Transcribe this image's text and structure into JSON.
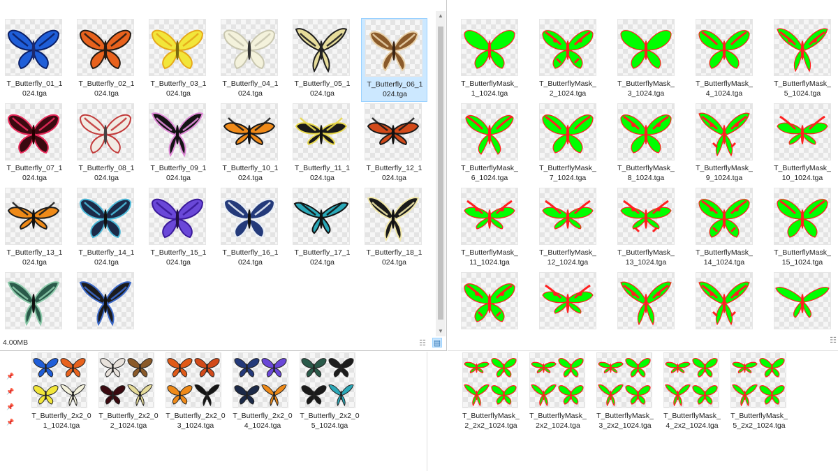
{
  "colors": {
    "mask_green": "#00ff00",
    "mask_red": "#ff2020",
    "selection": "#cce8ff"
  },
  "top_left": {
    "status": "4.00MB",
    "selected_index": 5,
    "scroll_up": "▲",
    "scroll_down": "▼",
    "view_details_icon": "☷",
    "view_tiles_icon": "▤",
    "items": [
      {
        "name": "T_Butterfly_01_1\n024.tga",
        "body": "#1e2a6e",
        "wing": "#1f5ed8",
        "accent": "#0b1f66",
        "shape": "morpho"
      },
      {
        "name": "T_Butterfly_02_1\n024.tga",
        "body": "#2a1a10",
        "wing": "#e8621d",
        "accent": "#231a14",
        "shape": "monarch"
      },
      {
        "name": "T_Butterfly_03_1\n024.tga",
        "body": "#7a6a10",
        "wing": "#f2e63a",
        "accent": "#e6a81a",
        "shape": "brimstone"
      },
      {
        "name": "T_Butterfly_04_1\n024.tga",
        "body": "#333",
        "wing": "#f4f2dc",
        "accent": "#c9c7b0",
        "shape": "white"
      },
      {
        "name": "T_Butterfly_05_1\n024.tga",
        "body": "#222",
        "wing": "#e6dc9a",
        "accent": "#1e1e1e",
        "shape": "swallow"
      },
      {
        "name": "T_Butterfly_06_1\n024.tga",
        "body": "#3a2414",
        "wing": "#8a5a2a",
        "accent": "#e8d0a8",
        "shape": "leaf"
      },
      {
        "name": "T_Butterfly_07_1\n024.tga",
        "body": "#200",
        "wing": "#3a0a10",
        "accent": "#e8285a",
        "shape": "round"
      },
      {
        "name": "T_Butterfly_08_1\n024.tga",
        "body": "#444",
        "wing": "#f1ece4",
        "accent": "#c23a3a",
        "shape": "apollo"
      },
      {
        "name": "T_Butterfly_09_1\n024.tga",
        "body": "#111",
        "wing": "#141414",
        "accent": "#e08ad8",
        "shape": "swallow"
      },
      {
        "name": "T_Butterfly_10_1\n024.tga",
        "body": "#111",
        "wing": "#f08a18",
        "accent": "#181818",
        "shape": "long"
      },
      {
        "name": "T_Butterfly_11_1\n024.tga",
        "body": "#111",
        "wing": "#1a1a1a",
        "accent": "#e8d84a",
        "shape": "long"
      },
      {
        "name": "T_Butterfly_12_1\n024.tga",
        "body": "#111",
        "wing": "#d24a1a",
        "accent": "#1a1a1a",
        "shape": "long"
      },
      {
        "name": "T_Butterfly_13_1\n024.tga",
        "body": "#111",
        "wing": "#ef8a18",
        "accent": "#1c1c1c",
        "shape": "long"
      },
      {
        "name": "T_Butterfly_14_1\n024.tga",
        "body": "#111",
        "wing": "#1c2a48",
        "accent": "#4ab8d8",
        "shape": "round"
      },
      {
        "name": "T_Butterfly_15_1\n024.tga",
        "body": "#221144",
        "wing": "#6a48d8",
        "accent": "#3a1a9a",
        "shape": "morpho"
      },
      {
        "name": "T_Butterfly_16_1\n024.tga",
        "body": "#111",
        "wing": "#243a7a",
        "accent": "#e8eef6",
        "shape": "round"
      },
      {
        "name": "T_Butterfly_17_1\n024.tga",
        "body": "#111",
        "wing": "#2aa8b8",
        "accent": "#111",
        "shape": "birdwing"
      },
      {
        "name": "T_Butterfly_18_1\n024.tga",
        "body": "#111",
        "wing": "#1a1a1a",
        "accent": "#f2e8a8",
        "shape": "swallow"
      },
      {
        "name": "",
        "body": "#111",
        "wing": "#2a5a4a",
        "accent": "#8ac8a8",
        "shape": "swallow"
      },
      {
        "name": "",
        "body": "#111",
        "wing": "#1c1c1c",
        "accent": "#3a68c8",
        "shape": "swallow"
      }
    ]
  },
  "top_right": {
    "view_details_icon": "☷",
    "items": [
      {
        "name": "T_ButterflyMask_\n1_1024.tga",
        "shape": "morpho",
        "red": 0
      },
      {
        "name": "T_ButterflyMask_\n2_1024.tga",
        "shape": "monarch",
        "red": 3
      },
      {
        "name": "T_ButterflyMask_\n3_1024.tga",
        "shape": "brimstone",
        "red": 0
      },
      {
        "name": "T_ButterflyMask_\n4_1024.tga",
        "shape": "white",
        "red": 1
      },
      {
        "name": "T_ButterflyMask_\n5_1024.tga",
        "shape": "swallow",
        "red": 2
      },
      {
        "name": "T_ButterflyMask_\n6_1024.tga",
        "shape": "leaf",
        "red": 1
      },
      {
        "name": "T_ButterflyMask_\n7_1024.tga",
        "shape": "round",
        "red": 1
      },
      {
        "name": "T_ButterflyMask_\n8_1024.tga",
        "shape": "apollo",
        "red": 2
      },
      {
        "name": "T_ButterflyMask_\n9_1024.tga",
        "shape": "swallow",
        "red": 3
      },
      {
        "name": "T_ButterflyMask_\n10_1024.tga",
        "shape": "long",
        "red": 1
      },
      {
        "name": "T_ButterflyMask_\n11_1024.tga",
        "shape": "long",
        "red": 2
      },
      {
        "name": "T_ButterflyMask_\n12_1024.tga",
        "shape": "long",
        "red": 1
      },
      {
        "name": "T_ButterflyMask_\n13_1024.tga",
        "shape": "long",
        "red": 3
      },
      {
        "name": "T_ButterflyMask_\n14_1024.tga",
        "shape": "round",
        "red": 3
      },
      {
        "name": "T_ButterflyMask_\n15_1024.tga",
        "shape": "morpho",
        "red": 1
      },
      {
        "name": "",
        "shape": "round",
        "red": 3
      },
      {
        "name": "",
        "shape": "long",
        "red": 2
      },
      {
        "name": "",
        "shape": "swallow",
        "red": 2
      },
      {
        "name": "",
        "shape": "swallow",
        "red": 3
      },
      {
        "name": "",
        "shape": "birdwing",
        "red": 0
      }
    ]
  },
  "bottom_left": {
    "pin_icon": "📌",
    "items": [
      {
        "name": "T_Butterfly_2x2_0\n1_1024.tga",
        "colors": [
          "#1f5ed8",
          "#e8621d",
          "#f2e63a",
          "#f4f2dc"
        ]
      },
      {
        "name": "T_Butterfly_2x2_0\n2_1024.tga",
        "colors": [
          "#e8e2dc",
          "#8a5a2a",
          "#3a0a10",
          "#e6dc9a"
        ]
      },
      {
        "name": "T_Butterfly_2x2_0\n3_1024.tga",
        "colors": [
          "#e05a18",
          "#d24a1a",
          "#ef8a18",
          "#141414"
        ]
      },
      {
        "name": "T_Butterfly_2x2_0\n4_1024.tga",
        "colors": [
          "#243a7a",
          "#6a48d8",
          "#1c2a48",
          "#ef8a18"
        ]
      },
      {
        "name": "T_Butterfly_2x2_0\n5_1024.tga",
        "colors": [
          "#2a5a4a",
          "#1c1c1c",
          "#1a1a1a",
          "#2aa8b8"
        ]
      }
    ]
  },
  "bottom_right": {
    "items": [
      {
        "name": "T_ButterflyMask_\n2_2x2_1024.tga"
      },
      {
        "name": "T_ButterflyMask_\n2x2_1024.tga"
      },
      {
        "name": "T_ButterflyMask_\n3_2x2_1024.tga"
      },
      {
        "name": "T_ButterflyMask_\n4_2x2_1024.tga"
      },
      {
        "name": "T_ButterflyMask_\n5_2x2_1024.tga"
      }
    ]
  }
}
